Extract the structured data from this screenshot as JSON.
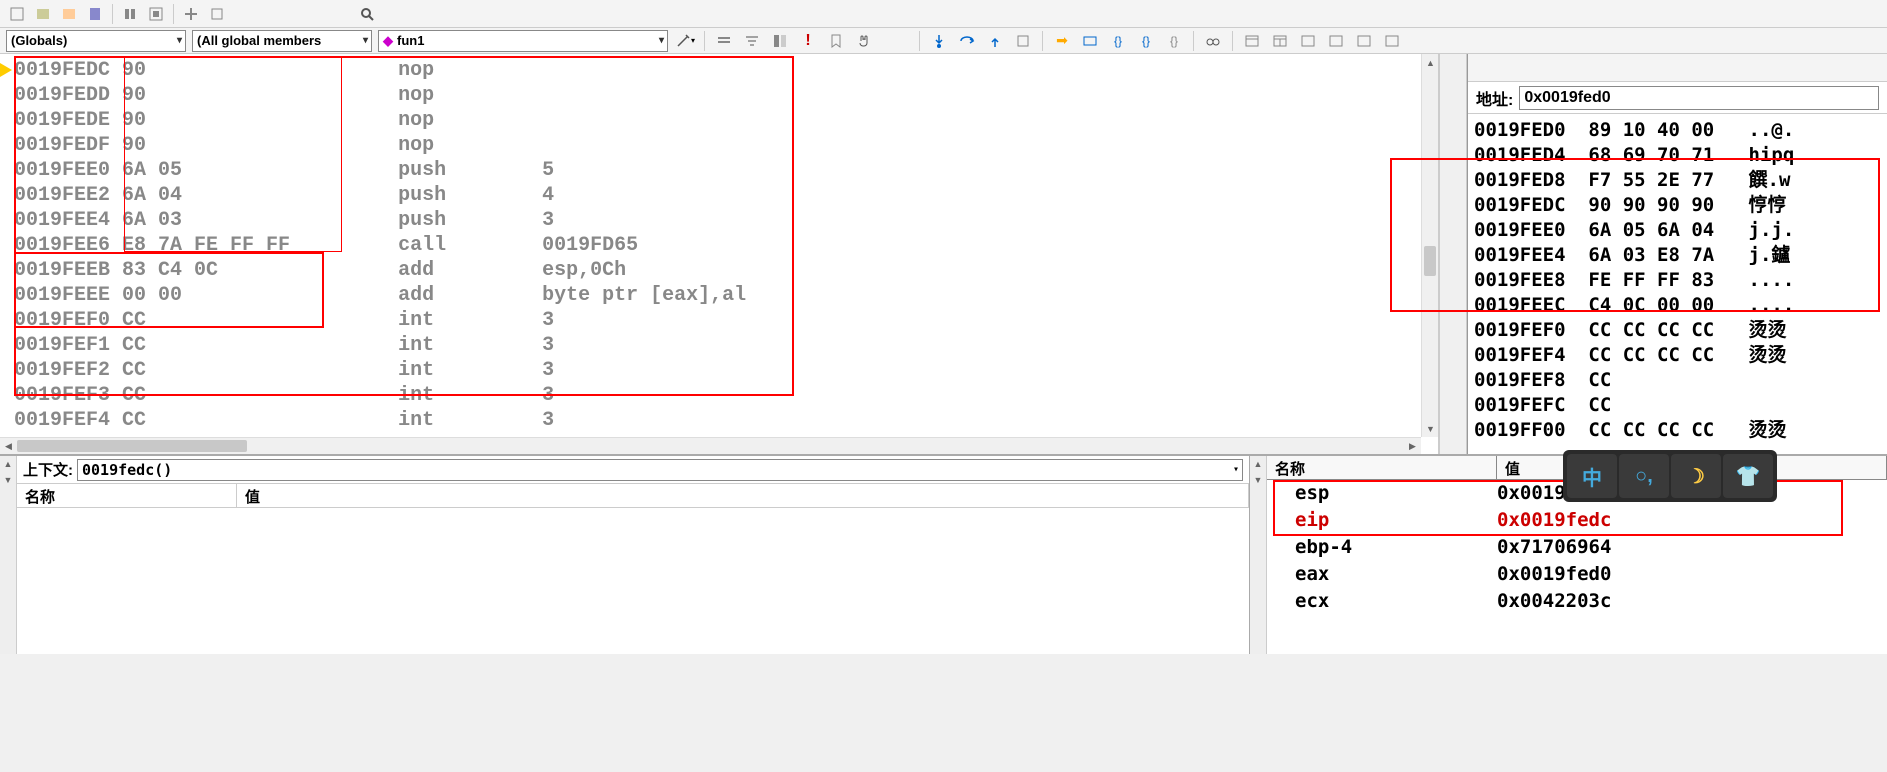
{
  "dropdowns": {
    "scope": "(Globals)",
    "members": "(All global members",
    "function": "fun1"
  },
  "disassembly": [
    {
      "addr": "0019FEDC",
      "bytes": "90",
      "mnem": "nop",
      "op": ""
    },
    {
      "addr": "0019FEDD",
      "bytes": "90",
      "mnem": "nop",
      "op": ""
    },
    {
      "addr": "0019FEDE",
      "bytes": "90",
      "mnem": "nop",
      "op": ""
    },
    {
      "addr": "0019FEDF",
      "bytes": "90",
      "mnem": "nop",
      "op": ""
    },
    {
      "addr": "0019FEE0",
      "bytes": "6A 05",
      "mnem": "push",
      "op": "5"
    },
    {
      "addr": "0019FEE2",
      "bytes": "6A 04",
      "mnem": "push",
      "op": "4"
    },
    {
      "addr": "0019FEE4",
      "bytes": "6A 03",
      "mnem": "push",
      "op": "3"
    },
    {
      "addr": "0019FEE6",
      "bytes": "E8 7A FE FF FF",
      "mnem": "call",
      "op": "0019FD65"
    },
    {
      "addr": "0019FEEB",
      "bytes": "83 C4 0C",
      "mnem": "add",
      "op": "esp,0Ch"
    },
    {
      "addr": "0019FEEE",
      "bytes": "00 00",
      "mnem": "add",
      "op": "byte ptr [eax],al"
    },
    {
      "addr": "0019FEF0",
      "bytes": "CC",
      "mnem": "int",
      "op": "3"
    },
    {
      "addr": "0019FEF1",
      "bytes": "CC",
      "mnem": "int",
      "op": "3"
    },
    {
      "addr": "0019FEF2",
      "bytes": "CC",
      "mnem": "int",
      "op": "3"
    },
    {
      "addr": "0019FEF3",
      "bytes": "CC",
      "mnem": "int",
      "op": "3"
    },
    {
      "addr": "0019FEF4",
      "bytes": "CC",
      "mnem": "int",
      "op": "3"
    }
  ],
  "memory": {
    "addr_label": "地址:",
    "addr_value": "0x0019fed0",
    "rows": [
      {
        "a": "0019FED0",
        "b": "89 10 40 00",
        "t": "..@."
      },
      {
        "a": "0019FED4",
        "b": "68 69 70 71",
        "t": "hipq"
      },
      {
        "a": "0019FED8",
        "b": "F7 55 2E 77",
        "t": "饌.w"
      },
      {
        "a": "0019FEDC",
        "b": "90 90 90 90",
        "t": "悙悙"
      },
      {
        "a": "0019FEE0",
        "b": "6A 05 6A 04",
        "t": "j.j."
      },
      {
        "a": "0019FEE4",
        "b": "6A 03 E8 7A",
        "t": "j.鑪"
      },
      {
        "a": "0019FEE8",
        "b": "FE FF FF 83",
        "t": "...."
      },
      {
        "a": "0019FEEC",
        "b": "C4 0C 00 00",
        "t": "...."
      },
      {
        "a": "0019FEF0",
        "b": "CC CC CC CC",
        "t": "烫烫"
      },
      {
        "a": "0019FEF4",
        "b": "CC CC CC CC",
        "t": "烫烫"
      },
      {
        "a": "0019FEF8",
        "b": "CC",
        "t": ""
      },
      {
        "a": "0019FEFC",
        "b": "CC",
        "t": ""
      },
      {
        "a": "0019FF00",
        "b": "CC CC CC CC",
        "t": "烫烫"
      }
    ]
  },
  "context": {
    "label": "上下文:",
    "value": "0019fedc()",
    "col_name": "名称",
    "col_value": "值"
  },
  "watch": {
    "col_name": "名称",
    "col_value": "值",
    "rows": [
      {
        "name": "esp",
        "value": "0x0019fedc",
        "red": false
      },
      {
        "name": "eip",
        "value": "0x0019fedc",
        "red": true
      },
      {
        "name": "ebp-4",
        "value": "0x71706964",
        "red": false
      },
      {
        "name": "eax",
        "value": "0x0019fed0",
        "red": false
      },
      {
        "name": "ecx",
        "value": "0x0042203c",
        "red": false
      }
    ]
  },
  "ime": [
    "中",
    "○,",
    "☽",
    "👕"
  ]
}
